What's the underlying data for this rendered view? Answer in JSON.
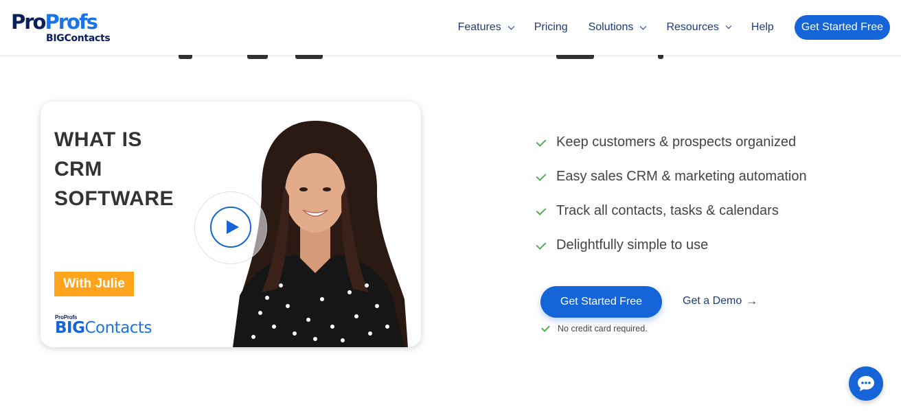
{
  "brand": {
    "logo_pro": "Pro",
    "logo_profs": "Profs",
    "logo_sub": "BIGContacts",
    "colors": {
      "primary": "#1565d8",
      "navy": "#0b1f5c",
      "accent": "#ffa41c",
      "check": "#4caf50"
    }
  },
  "nav": {
    "items": [
      {
        "label": "Features",
        "has_dropdown": true
      },
      {
        "label": "Pricing",
        "has_dropdown": false
      },
      {
        "label": "Solutions",
        "has_dropdown": true
      },
      {
        "label": "Resources",
        "has_dropdown": true
      },
      {
        "label": "Help",
        "has_dropdown": false
      }
    ],
    "cta_label": "Get Started Free"
  },
  "video": {
    "title_lines": [
      "WHAT IS",
      "CRM",
      "SOFTWARE"
    ],
    "badge": "With Julie",
    "logo_small": "ProProfs",
    "logo_big_bold": "BIG",
    "logo_big_rest": "Contacts",
    "play_icon": "play-icon"
  },
  "features": [
    "Keep customers & prospects organized",
    "Easy sales CRM & marketing automation",
    "Track all contacts, tasks & calendars",
    "Delightfully simple to use"
  ],
  "cta": {
    "primary_label": "Get Started Free",
    "demo_label": "Get a Demo",
    "demo_arrow": "→",
    "note": "No credit card required."
  },
  "chat": {
    "icon": "chat-icon"
  }
}
